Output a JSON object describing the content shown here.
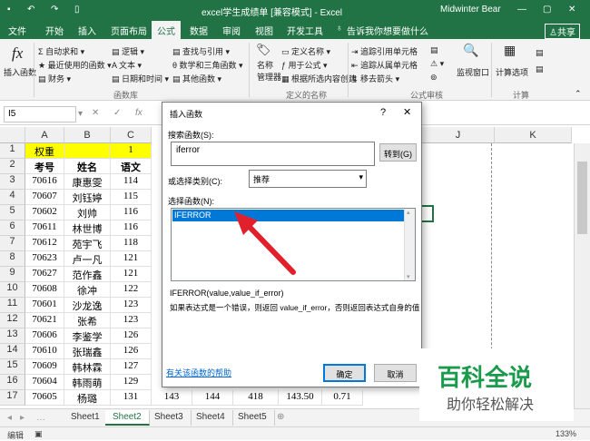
{
  "titlebar": {
    "title": "excel学生成绩单  [兼容模式]  -  Excel",
    "user": "Midwinter Bear"
  },
  "tabs": [
    "文件",
    "开始",
    "插入",
    "页面布局",
    "公式",
    "数据",
    "审阅",
    "视图",
    "开发工具",
    "告诉我你想要做什么",
    "共享"
  ],
  "ribbon": {
    "insert_func": [
      "fx",
      "插入函数"
    ],
    "lib": [
      "自动求和",
      "最近使用的函数",
      "财务",
      "逻辑",
      "文本",
      "日期和时间",
      "查找与引用",
      "数学和三角函数",
      "其他函数"
    ],
    "names": [
      "名称",
      "管理器",
      "定义名称",
      "用于公式",
      "根据所选内容创建"
    ],
    "audit": [
      "追踪引用单元格",
      "追踪从属单元格",
      "移去箭头"
    ],
    "watch": "监视窗口",
    "calc": "计算选项",
    "groups": [
      "函数库",
      "定义的名称",
      "公式审核",
      "计算"
    ]
  },
  "namebox": "I5",
  "fx_label": "fx",
  "columns": [
    "A",
    "B",
    "C",
    "J",
    "K"
  ],
  "rows": [
    "1",
    "2",
    "3",
    "4",
    "5",
    "6",
    "7",
    "8",
    "9",
    "10",
    "11",
    "12",
    "13",
    "14",
    "15",
    "16",
    "17"
  ],
  "r1": {
    "a": "权重",
    "c": "1"
  },
  "r2": {
    "a": "考号",
    "b": "姓名",
    "c": "语文"
  },
  "table": [
    [
      "70616",
      "康惠雯",
      "114"
    ],
    [
      "70607",
      "刘钰婷",
      "115"
    ],
    [
      "70602",
      "刘帅",
      "116"
    ],
    [
      "70611",
      "林世博",
      "116"
    ],
    [
      "70612",
      "苑宇飞",
      "118"
    ],
    [
      "70623",
      "卢一凡",
      "121"
    ],
    [
      "70627",
      "范作鑫",
      "121"
    ],
    [
      "70608",
      "徐冲",
      "122"
    ],
    [
      "70601",
      "沙龙逸",
      "123"
    ],
    [
      "70621",
      "张希",
      "123"
    ],
    [
      "70606",
      "李鉴学",
      "126"
    ],
    [
      "70610",
      "张瑞鑫",
      "126"
    ],
    [
      "70609",
      "韩林霖",
      "127"
    ],
    [
      "70604",
      "韩雨萌",
      "129"
    ]
  ],
  "row17": [
    "70605",
    "杨璐",
    "131",
    "143",
    "144",
    "418",
    "143.50",
    "0.71"
  ],
  "dialog": {
    "title": "插入函数",
    "help": "?",
    "close": "✕",
    "search_label": "搜索函数(S):",
    "search_value": "iferror",
    "go": "转到(G)",
    "category_label": "或选择类别(C):",
    "category_value": "推荐",
    "select_label": "选择函数(N):",
    "selected": "IFERROR",
    "signature": "IFERROR(value,value_if_error)",
    "description": "如果表达式是一个错误，则返回 value_if_error，否则返回表达式自身的值",
    "help_link": "有关该函数的帮助",
    "ok": "确定",
    "cancel": "取消"
  },
  "sheets": [
    "Sheet1",
    "Sheet2",
    "Sheet3",
    "Sheet4",
    "Sheet5"
  ],
  "active_sheet": "Sheet2",
  "status": {
    "left": "编辑",
    "zoom": "133%"
  },
  "watermark": {
    "title": "百科全说",
    "subtitle": "助你轻松解决"
  },
  "colors": {
    "excel_green": "#217346",
    "highlight": "#ffff00",
    "select_blue": "#0078d7",
    "arrow": "#e0202a"
  }
}
